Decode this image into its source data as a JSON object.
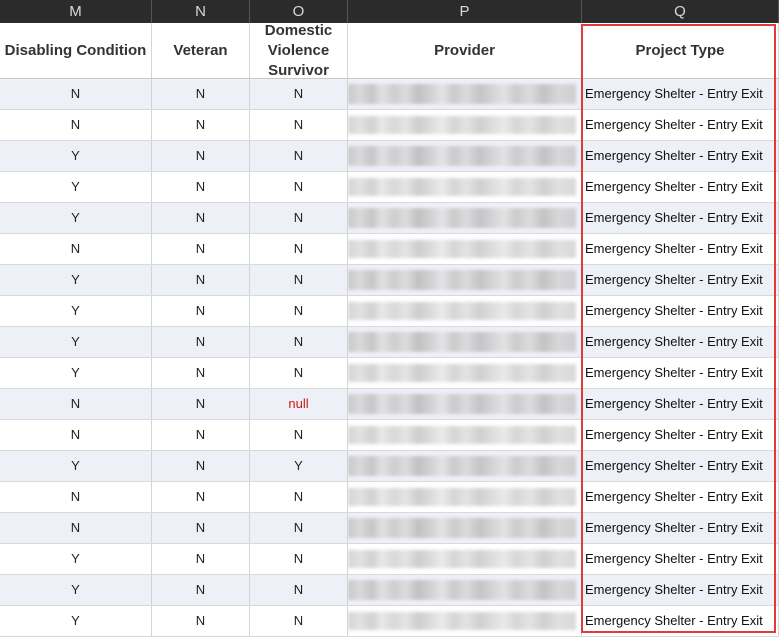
{
  "columns": {
    "letters": [
      "M",
      "N",
      "O",
      "P",
      "Q"
    ],
    "headers": [
      "Disabling Condition",
      "Veteran",
      "Domestic Violence Survivor",
      "Provider",
      "Project Type"
    ]
  },
  "rows": [
    {
      "disabling": "N",
      "veteran": "N",
      "dv": "N",
      "project_type": "Emergency Shelter - Entry Exit"
    },
    {
      "disabling": "N",
      "veteran": "N",
      "dv": "N",
      "project_type": "Emergency Shelter - Entry Exit"
    },
    {
      "disabling": "Y",
      "veteran": "N",
      "dv": "N",
      "project_type": "Emergency Shelter - Entry Exit"
    },
    {
      "disabling": "Y",
      "veteran": "N",
      "dv": "N",
      "project_type": "Emergency Shelter - Entry Exit"
    },
    {
      "disabling": "Y",
      "veteran": "N",
      "dv": "N",
      "project_type": "Emergency Shelter - Entry Exit"
    },
    {
      "disabling": "N",
      "veteran": "N",
      "dv": "N",
      "project_type": "Emergency Shelter - Entry Exit"
    },
    {
      "disabling": "Y",
      "veteran": "N",
      "dv": "N",
      "project_type": "Emergency Shelter - Entry Exit"
    },
    {
      "disabling": "Y",
      "veteran": "N",
      "dv": "N",
      "project_type": "Emergency Shelter - Entry Exit"
    },
    {
      "disabling": "Y",
      "veteran": "N",
      "dv": "N",
      "project_type": "Emergency Shelter - Entry Exit"
    },
    {
      "disabling": "Y",
      "veteran": "N",
      "dv": "N",
      "project_type": "Emergency Shelter - Entry Exit"
    },
    {
      "disabling": "N",
      "veteran": "N",
      "dv": "null",
      "project_type": "Emergency Shelter - Entry Exit"
    },
    {
      "disabling": "N",
      "veteran": "N",
      "dv": "N",
      "project_type": "Emergency Shelter - Entry Exit"
    },
    {
      "disabling": "Y",
      "veteran": "N",
      "dv": "Y",
      "project_type": "Emergency Shelter - Entry Exit"
    },
    {
      "disabling": "N",
      "veteran": "N",
      "dv": "N",
      "project_type": "Emergency Shelter - Entry Exit"
    },
    {
      "disabling": "N",
      "veteran": "N",
      "dv": "N",
      "project_type": "Emergency Shelter - Entry Exit"
    },
    {
      "disabling": "Y",
      "veteran": "N",
      "dv": "N",
      "project_type": "Emergency Shelter - Entry Exit"
    },
    {
      "disabling": "Y",
      "veteran": "N",
      "dv": "N",
      "project_type": "Emergency Shelter - Entry Exit"
    },
    {
      "disabling": "Y",
      "veteran": "N",
      "dv": "N",
      "project_type": "Emergency Shelter - Entry Exit"
    }
  ],
  "colors": {
    "column_letter_bar": "#2b2b2b",
    "row_stripe": "#eef0f8",
    "null_text": "#d01818",
    "highlight_border": "#e03a3a"
  }
}
